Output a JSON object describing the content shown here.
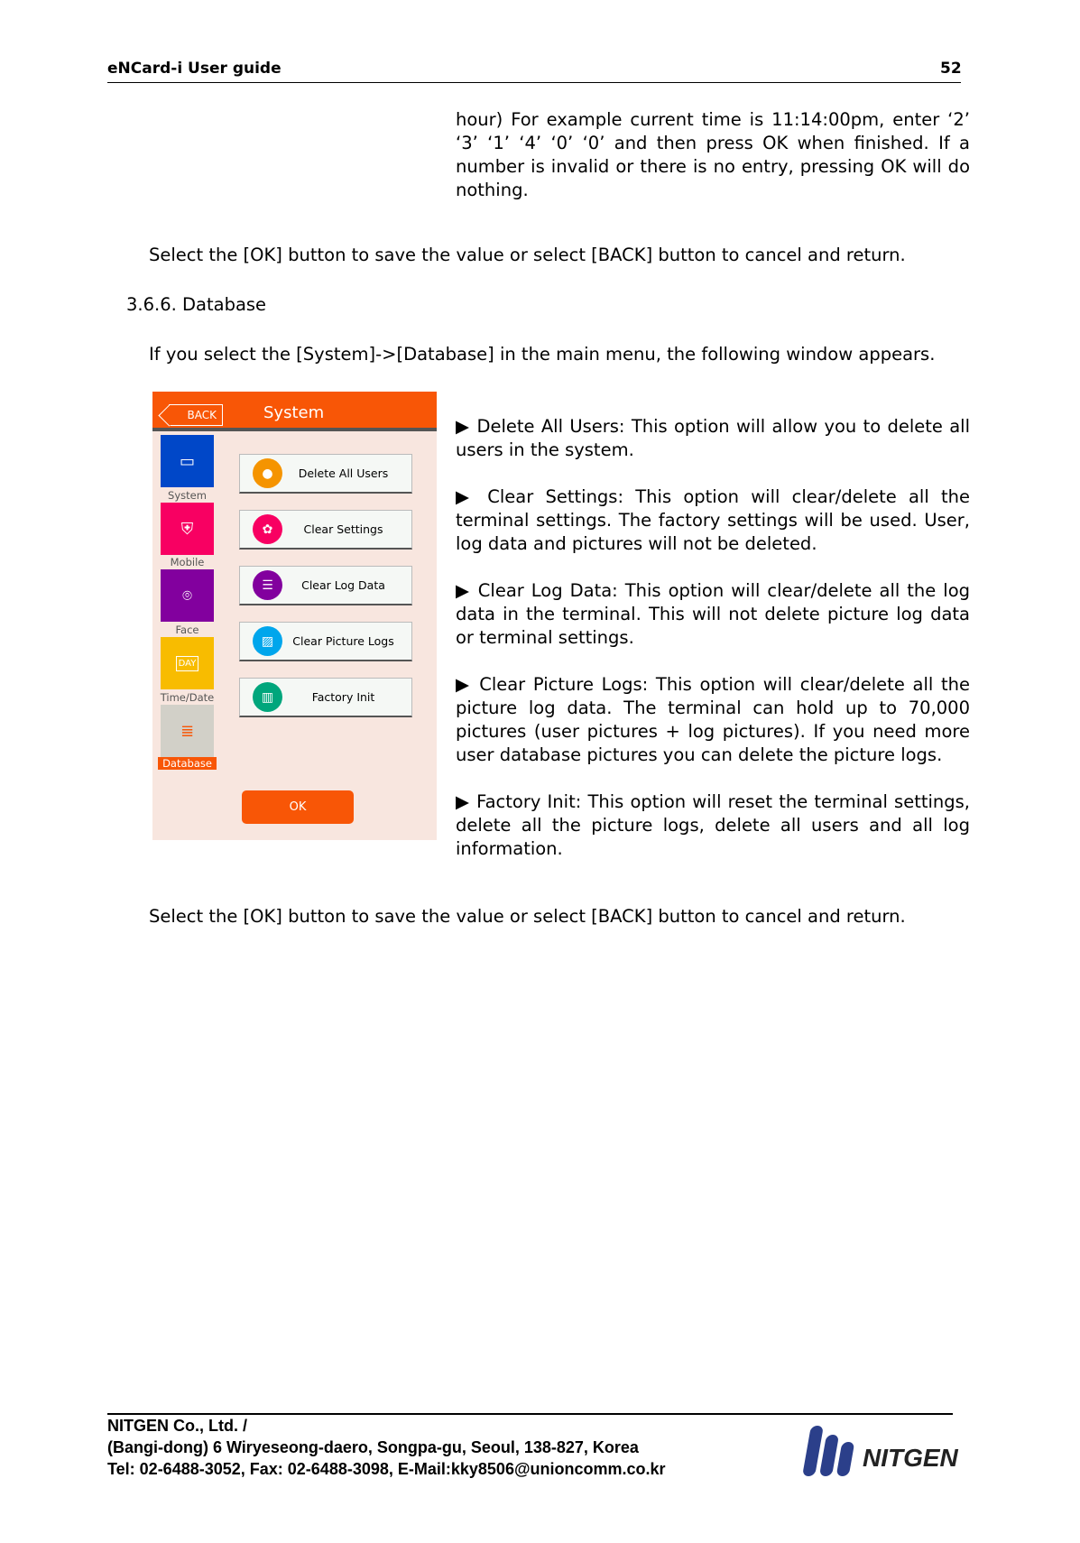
{
  "header": {
    "title": "eNCard-i User guide",
    "page": "52"
  },
  "intro": "hour) For example current time is 11:14:00pm, enter ‘2’ ‘3’ ‘1’ ‘4’ ‘0’ ‘0’ and then press OK when finished. If a number is invalid or there is no entry, pressing OK will do nothing.",
  "select_text_1": "Select the [OK] button to save the value or select [BACK] button to cancel and return.",
  "section_title": "3.6.6. Database",
  "section_intro": "If you select the [System]->[Database] in the main menu, the following window appears.",
  "device": {
    "back_label": "BACK",
    "title": "System",
    "ok_label": "OK",
    "sidebar": [
      {
        "label": "System",
        "icon": "window-icon",
        "color": "#0047c8"
      },
      {
        "label": "Mobile",
        "icon": "shield-icon",
        "color": "#f80062"
      },
      {
        "label": "Face",
        "icon": "face-scan-icon",
        "color": "#82009e"
      },
      {
        "label": "Time/Date",
        "icon": "calendar-day-icon",
        "color": "#f8bc00"
      },
      {
        "label": "Database",
        "icon": "database-icon",
        "color": "#d2d0c8",
        "selected": true
      }
    ],
    "options": [
      {
        "label": "Delete All Users",
        "icon": "user-icon",
        "color": "#f59400"
      },
      {
        "label": "Clear Settings",
        "icon": "gear-icon",
        "color": "#f80062"
      },
      {
        "label": "Clear Log Data",
        "icon": "list-icon",
        "color": "#82009e"
      },
      {
        "label": "Clear Picture Logs",
        "icon": "picture-icon",
        "color": "#00a6ec"
      },
      {
        "label": "Factory Init",
        "icon": "trash-icon",
        "color": "#00a67c"
      }
    ]
  },
  "bullets": [
    "Delete All Users: This option will allow you to delete all users in the system.",
    "Clear Settings: This option will clear/delete all the terminal settings. The factory settings will be used. User, log data and pictures will not be deleted.",
    "Clear Log Data: This option will clear/delete all the log data in the terminal. This will not delete picture log data or terminal settings.",
    "Clear Picture Logs: This option will clear/delete all the picture log data. The terminal can hold up to 70,000 pictures (user pictures + log pictures). If you need more user database pictures you can delete the picture logs.",
    "Factory Init: This option will reset the terminal settings, delete all the picture logs, delete all users and all log information."
  ],
  "bullet_marker": "▶",
  "select_text_2": "Select the [OK] button to save the value or select [BACK] button to cancel and return.",
  "footer": {
    "company": "NITGEN Co., Ltd. /",
    "address": "(Bangi-dong) 6 Wiryeseong-daero, Songpa-gu, Seoul, 138-827, Korea",
    "contact": "Tel: 02-6488-3052, Fax: 02-6488-3098, E-Mail:kky8506@unioncomm.co.kr",
    "logo_text": "NITGEN"
  }
}
